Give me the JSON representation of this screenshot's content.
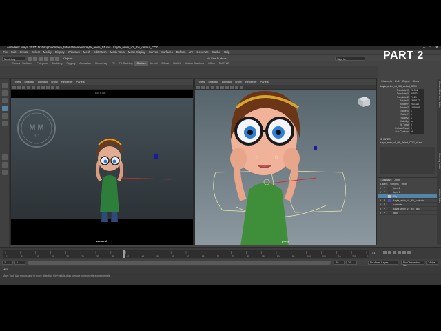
{
  "window": {
    "title": "Autodesk Maya 2017: D:\\Dropbox\\maya_tutorial\\scenes\\kayla_anim_01.ma - kayla_anim_v1_.hs_defaul_COG",
    "controls": [
      "–",
      "□",
      "✕"
    ]
  },
  "overlay": {
    "part_label": "PART 2"
  },
  "menubar": [
    "File",
    "Edit",
    "Create",
    "Select",
    "Modify",
    "Display",
    "Windows",
    "Mesh",
    "Edit Mesh",
    "Mesh Tools",
    "Mesh Display",
    "Curves",
    "Surfaces",
    "Deform",
    "UV",
    "Generate",
    "Cache",
    "Help"
  ],
  "statusline": {
    "mode": "Modeling",
    "objects_label": "Objects",
    "live_surface": "No Live Surface",
    "sign_in": "Sign In"
  },
  "shelf_tabs": [
    "Curves / Surfaces",
    "Polygons",
    "Sculpting",
    "Rigging",
    "Animation",
    "Rendering",
    "FX",
    "FX Caching",
    "Custom",
    "Arnold",
    "Bifrost",
    "MASH",
    "Motion Graphics",
    "XGen",
    "TURTLE"
  ],
  "active_shelf_tab": "Custom",
  "viewport_left": {
    "menu": [
      "View",
      "Shading",
      "Lighting",
      "Show",
      "Renderer",
      "Panels"
    ],
    "top_readout": "640 x 360",
    "camera_label": "camera1"
  },
  "viewport_right": {
    "menu": [
      "View",
      "Shading",
      "Lighting",
      "Show",
      "Renderer",
      "Panels"
    ],
    "camera_label": "persp",
    "viewcube_label": "FRONT"
  },
  "watermark": {
    "line1": "M M",
    "line2": "3D"
  },
  "channel_box": {
    "menu": [
      "Channels",
      "Edit",
      "Object",
      "Show"
    ],
    "node_name": "kayla_anim_v1_95i_defaul_COG",
    "attributes": [
      {
        "name": "Translate X",
        "value": "26.951"
      },
      {
        "name": "Translate Y",
        "value": "-6.512"
      },
      {
        "name": "Translate Z",
        "value": "74.25"
      },
      {
        "name": "Rotate X",
        "value": "-399.171"
      },
      {
        "name": "Rotate Y",
        "value": "203.822"
      },
      {
        "name": "Rotate Z",
        "value": "-129.465"
      },
      {
        "name": "Scale X",
        "value": "1"
      },
      {
        "name": "Scale Y",
        "value": "1"
      },
      {
        "name": "Scale Z",
        "value": "1"
      },
      {
        "name": "Visibility",
        "value": "on"
      },
      {
        "name": "IK Twist",
        "value": "0"
      },
      {
        "name": "Follow Chest",
        "value": "0"
      },
      {
        "name": "Sub Controls",
        "value": "off"
      }
    ],
    "shapes_label": "SHAPES",
    "shape_name": "kayla_anim_v1_95i_defaul_COG_shape"
  },
  "layer_editor": {
    "tabs": [
      "Display",
      "Anim"
    ],
    "menu": [
      "Layers",
      "Options",
      "Help"
    ],
    "layers": [
      {
        "v": "V",
        "p": "P",
        "name": "layer2",
        "color": "#3c3c3c"
      },
      {
        "v": "V",
        "p": "P",
        "name": "layer1",
        "color": "#3c3c3c"
      },
      {
        "v": "",
        "p": "",
        "name": "Rig",
        "color": "#c0c0c0",
        "selected": true
      },
      {
        "v": "V",
        "p": "P",
        "name": "kayla_anim_v1_95i_controls",
        "color": "#3b4cc7"
      },
      {
        "v": "V",
        "p": "P",
        "name": "controls",
        "color": "#3c3c3c"
      },
      {
        "v": "V",
        "p": "P",
        "name": "kayla_anim_v1_95i_geo",
        "color": "#3c3c3c"
      },
      {
        "v": "V",
        "p": "P",
        "name": "geo",
        "color": "#3c3c3c"
      }
    ]
  },
  "timeline": {
    "ticks": [
      "1",
      "5",
      "10",
      "15",
      "20",
      "25",
      "30",
      "35",
      "40",
      "45",
      "50",
      "55",
      "60",
      "65",
      "70",
      "75",
      "80",
      "85",
      "90",
      "95",
      "100",
      "105",
      "110",
      "115",
      "120"
    ],
    "current_frame": "41"
  },
  "range": {
    "start": "1",
    "inner_start": "1",
    "inner_end": "76",
    "end": "76",
    "anim_layer": "No Anim Layer",
    "character_set": "No Character Set",
    "fps": "24 fps"
  },
  "command_line": {
    "label": "MEL"
  },
  "help_line": {
    "text": "Move Tool: Use manipulator to move object(s). Ctrl+middle-drag to move components along normals."
  },
  "side_tabs": [
    "Channel Box / Layer Editor",
    "Modeling Toolkit",
    "Attribute Editor"
  ],
  "colors": {
    "accent": "#5285a6",
    "maya_logo": "#3fb4c6"
  }
}
